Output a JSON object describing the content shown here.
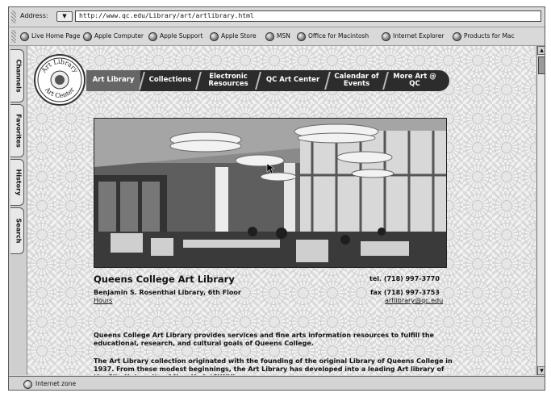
{
  "toolbar": {
    "address_label": "Address:",
    "url": "http://www.qc.edu/Library/art/artlibrary.html"
  },
  "favorites": [
    {
      "label": "Live Home Page"
    },
    {
      "label": "Apple Computer"
    },
    {
      "label": "Apple Support"
    },
    {
      "label": "Apple Store"
    },
    {
      "label": "MSN"
    },
    {
      "label": "Office for Macintosh"
    },
    {
      "label": "Internet Explorer"
    },
    {
      "label": "Products for Mac"
    }
  ],
  "side_tabs": [
    "Channels",
    "Favorites",
    "History",
    "Search"
  ],
  "logo": {
    "top_text": "Art Library",
    "bottom_text": "Art Center"
  },
  "nav": [
    {
      "label": "Art Library"
    },
    {
      "label": "Collections"
    },
    {
      "label": "Electronic Resources"
    },
    {
      "label": "QC Art Center"
    },
    {
      "label": "Calendar of Events"
    },
    {
      "label": "More Art @ QC"
    }
  ],
  "page": {
    "title": "Queens College Art Library",
    "location": "Benjamin S. Rosenthal Library, 6th Floor",
    "hours_link": "Hours",
    "tel": "tel. (718) 997-3770",
    "fax": "fax (718) 997-3753",
    "email": "artlibrary@qc.edu",
    "para1": "Queens College Art Library provides services and fine arts information resources to fulfill the educational, research, and cultural goals of Queens College.",
    "para2": "The Art Library collection originated with the founding of the original Library of Queens College in 1937.  From these modest beginnings, the Art Library has developed into  a leading Art library of the City University of New York (CUNY)."
  },
  "status": {
    "zone": "Internet zone"
  },
  "icons": [
    "dropdown-arrow-icon",
    "favorite-globe-icon",
    "internet-zone-icon",
    "scroll-up-icon",
    "scroll-down-icon"
  ]
}
